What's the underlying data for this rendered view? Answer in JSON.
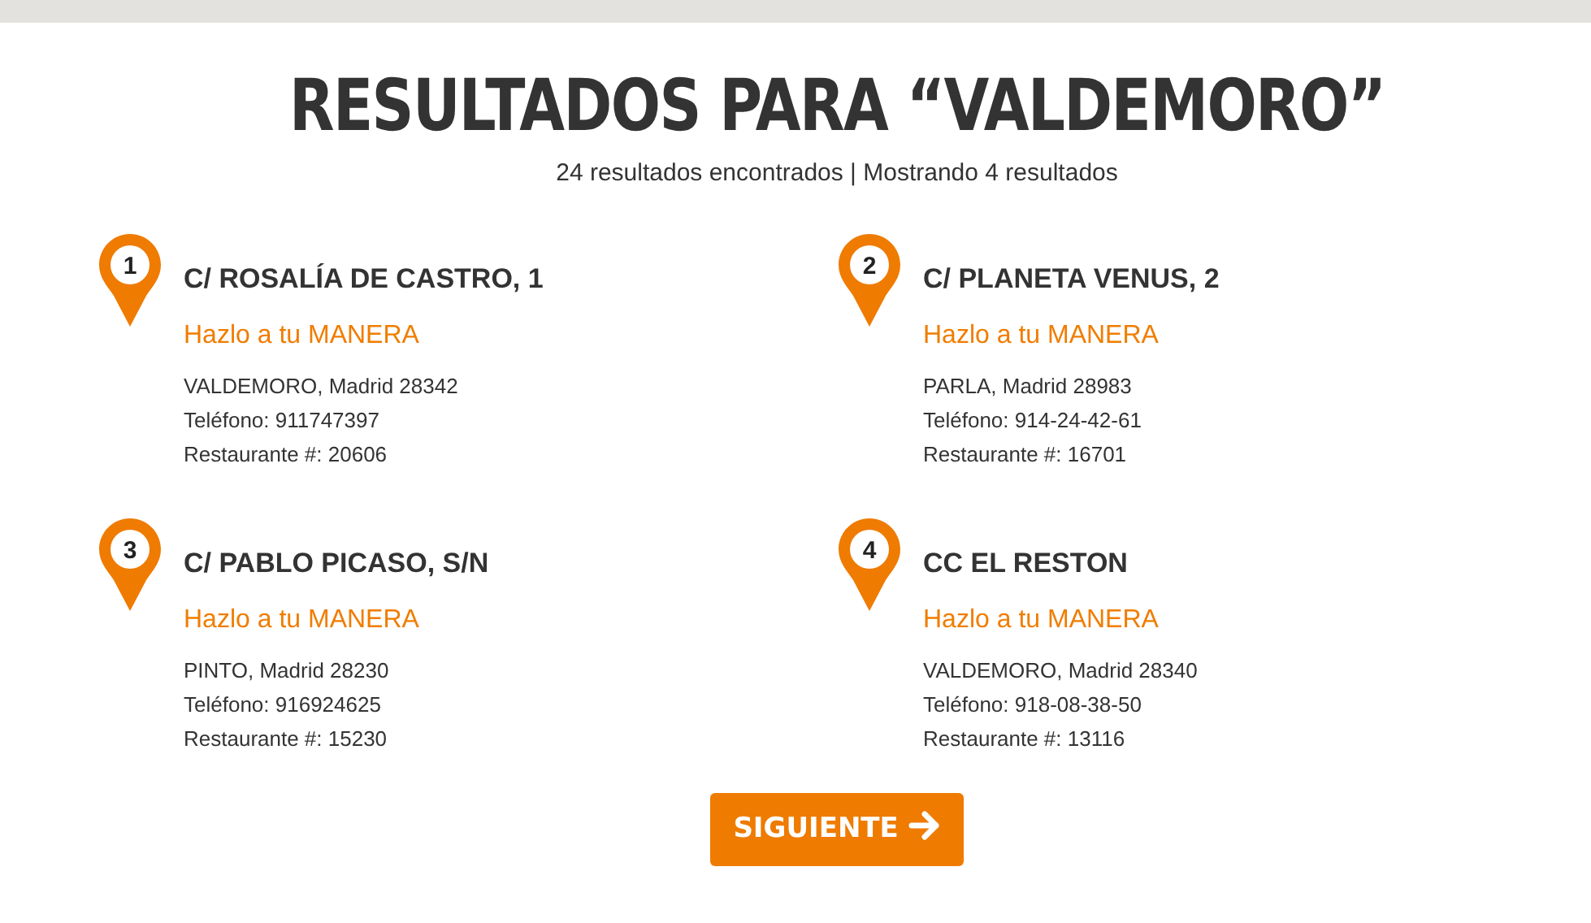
{
  "title": "RESULTADOS PARA “VALDEMORO”",
  "summary": "24 resultados encontrados | Mostrando 4 resultados",
  "results": [
    {
      "number": "1",
      "address": "C/ ROSALÍA DE CASTRO, 1",
      "tagline": "Hazlo a tu MANERA",
      "city": "VALDEMORO, Madrid 28342",
      "phone": "Teléfono: 911747397",
      "restaurant": "Restaurante #: 20606"
    },
    {
      "number": "2",
      "address": "C/ PLANETA VENUS, 2",
      "tagline": "Hazlo a tu MANERA",
      "city": "PARLA, Madrid 28983",
      "phone": "Teléfono: 914-24-42-61",
      "restaurant": "Restaurante #: 16701"
    },
    {
      "number": "3",
      "address": "C/ PABLO PICASO, S/N",
      "tagline": "Hazlo a tu MANERA",
      "city": "PINTO, Madrid 28230",
      "phone": "Teléfono: 916924625",
      "restaurant": "Restaurante #: 15230"
    },
    {
      "number": "4",
      "address": "CC EL RESTON",
      "tagline": "Hazlo a tu MANERA",
      "city": "VALDEMORO, Madrid 28340",
      "phone": "Teléfono: 918-08-38-50",
      "restaurant": "Restaurante #: 13116"
    }
  ],
  "next_button": "SIGUIENTE"
}
